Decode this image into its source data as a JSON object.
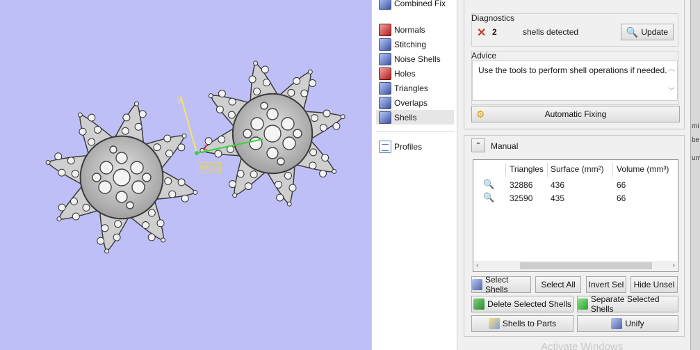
{
  "tools": {
    "top_partial": "Combined Fix",
    "items": [
      {
        "label": "Normals",
        "icon": "normals-icon"
      },
      {
        "label": "Stitching",
        "icon": "stitching-icon"
      },
      {
        "label": "Noise Shells",
        "icon": "noise-shells-icon"
      },
      {
        "label": "Holes",
        "icon": "holes-icon"
      },
      {
        "label": "Triangles",
        "icon": "triangles-icon"
      },
      {
        "label": "Overlaps",
        "icon": "overlaps-icon"
      },
      {
        "label": "Shells",
        "icon": "shells-icon",
        "selected": true
      }
    ],
    "profiles": "Profiles"
  },
  "viewport": {
    "axis_z": "z",
    "axis_y": "y",
    "wcs": "WCS",
    "background": "#bfbff8"
  },
  "diagnostics": {
    "title": "Diagnostics",
    "count": "2",
    "text": "shells detected",
    "update_button": "Update"
  },
  "advice": {
    "title": "Advice",
    "text": "Use the tools to perform shell operations if needed."
  },
  "auto_fix_button": "Automatic Fixing",
  "manual": {
    "title": "Manual",
    "columns": [
      "Triangles",
      "Surface (mm²)",
      "Volume (mm³)"
    ],
    "rows": [
      {
        "triangles": "32886",
        "surface": "436",
        "volume": "66"
      },
      {
        "triangles": "32590",
        "surface": "435",
        "volume": "66"
      }
    ]
  },
  "buttons": {
    "select_shells": "Select Shells",
    "select_all": "Select All",
    "invert_sel": "Invert Sel",
    "hide_unsel": "Hide Unsel",
    "delete_selected": "Delete Selected Shells",
    "separate_selected": "Separate Selected Shells",
    "shells_to_parts": "Shells to Parts",
    "unify": "Unify"
  },
  "edge_labels": [
    "mi",
    "be",
    "um"
  ],
  "watermark": "Activate Windows"
}
